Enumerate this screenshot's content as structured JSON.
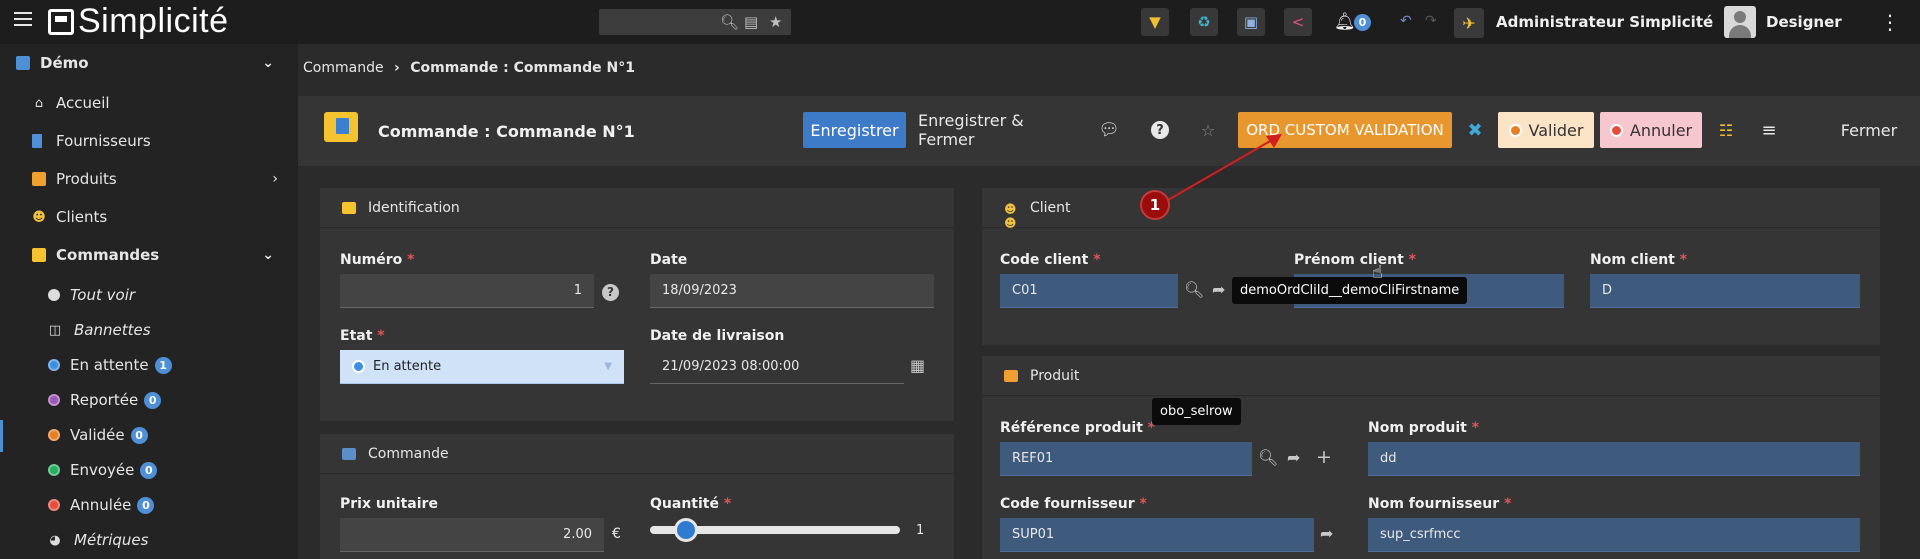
{
  "topbar": {
    "app_name": "Simplicité",
    "notifications_count": "0",
    "user_name": "Administrateur Simplicité",
    "designer_label": "Designer"
  },
  "sidebar": {
    "group_title": "Démo",
    "items": [
      {
        "label": "Accueil"
      },
      {
        "label": "Fournisseurs"
      },
      {
        "label": "Produits"
      },
      {
        "label": "Clients"
      },
      {
        "label": "Commandes"
      }
    ],
    "sub_items": [
      {
        "label": "Tout voir"
      },
      {
        "label": "Bannettes"
      },
      {
        "label": "En attente",
        "count": "1",
        "color": "#3d8fe0"
      },
      {
        "label": "Reportée",
        "count": "0",
        "color": "#9b59b6"
      },
      {
        "label": "Validée",
        "count": "0",
        "color": "#e67e22"
      },
      {
        "label": "Envoyée",
        "count": "0",
        "color": "#27ae60"
      },
      {
        "label": "Annulée",
        "count": "0",
        "color": "#e74c3c"
      },
      {
        "label": "Métriques"
      }
    ]
  },
  "breadcrumb": {
    "parent": "Commande",
    "current": "Commande : Commande N°1"
  },
  "header": {
    "title": "Commande : Commande N°1",
    "save_label": "Enregistrer",
    "save_close_label": "Enregistrer & Fermer",
    "custom_label": "ORD CUSTOM VALIDATION",
    "valider_label": "Valider",
    "annuler_label": "Annuler",
    "fermer_label": "Fermer"
  },
  "identification": {
    "title": "Identification",
    "numero_label": "Numéro",
    "numero_value": "1",
    "date_label": "Date",
    "date_value": "18/09/2023",
    "etat_label": "Etat",
    "etat_value": "En attente",
    "livraison_label": "Date de livraison",
    "livraison_value": "21/09/2023 08:00:00"
  },
  "commande": {
    "title": "Commande",
    "prix_label": "Prix unitaire",
    "prix_value": "2.00",
    "currency": "€",
    "quantite_label": "Quantité",
    "quantite_value": "1"
  },
  "client": {
    "title": "Client",
    "code_label": "Code client",
    "code_value": "C01",
    "prenom_label": "Prénom client",
    "nom_label": "Nom client",
    "nom_value": "D"
  },
  "produit": {
    "title": "Produit",
    "ref_label": "Référence produit",
    "ref_value": "REF01",
    "nom_label": "Nom produit",
    "nom_value": "dd",
    "fourn_code_label": "Code fournisseur",
    "fourn_code_value": "SUP01",
    "fourn_nom_label": "Nom fournisseur",
    "fourn_nom_value": "sup_csrfmcc"
  },
  "tooltips": {
    "firstname": "demoOrdCliId__demoCliFirstname",
    "selrow": "obo_selrow"
  },
  "annotation": {
    "marker": "1"
  },
  "colors": {
    "accent": "#3d7ac7",
    "custom_button": "#e8962e"
  }
}
